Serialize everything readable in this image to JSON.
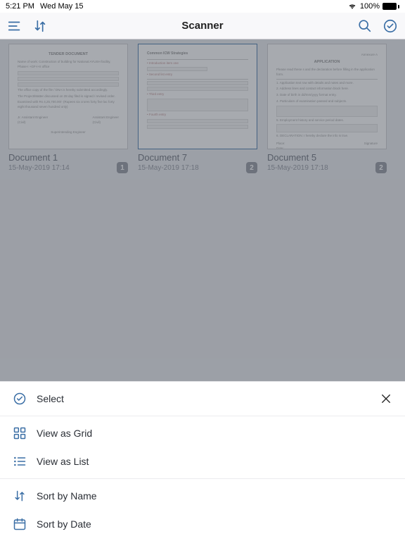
{
  "status": {
    "time": "5:21 PM",
    "date": "Wed May 15",
    "battery_pct": "100%"
  },
  "nav": {
    "title": "Scanner"
  },
  "documents": [
    {
      "name": "Document 1",
      "date": "15-May-2019 17:14",
      "pages": "1",
      "thumb_title": "TENDER DOCUMENT"
    },
    {
      "name": "Document 7",
      "date": "15-May-2019 17:18",
      "pages": "2",
      "thumb_title": "Common ICW Strategies"
    },
    {
      "name": "Document 5",
      "date": "15-May-2019 17:18",
      "pages": "2",
      "thumb_title": "APPLICATION"
    }
  ],
  "sheet": {
    "select": "Select",
    "view_grid": "View as Grid",
    "view_list": "View as List",
    "sort_name": "Sort by Name",
    "sort_date": "Sort by Date"
  },
  "colors": {
    "accent": "#3a6ea5"
  }
}
